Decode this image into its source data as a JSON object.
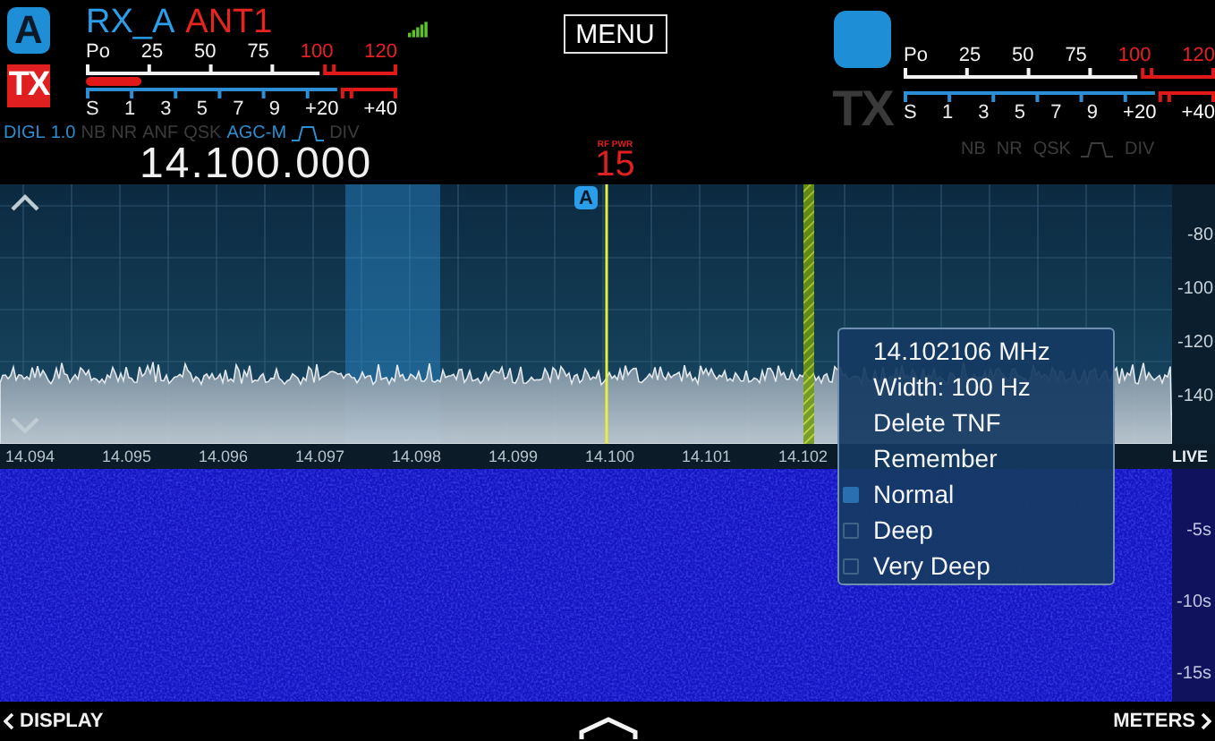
{
  "header": {
    "menu_button": "MENU",
    "rf_power": {
      "label": "RF PWR",
      "value": "15"
    }
  },
  "receivers": [
    {
      "badge": "A",
      "name": "RX_A",
      "antenna": "ANT1",
      "tx": {
        "label": "TX",
        "active": true
      },
      "power_scale": [
        {
          "text": "Po",
          "kind": "normal"
        },
        {
          "text": "25",
          "kind": "normal"
        },
        {
          "text": "50",
          "kind": "normal"
        },
        {
          "text": "75",
          "kind": "normal"
        },
        {
          "text": "100",
          "kind": "over"
        },
        {
          "text": "120",
          "kind": "over"
        }
      ],
      "power_meter": {
        "level": 0.18
      },
      "s_scale": [
        {
          "text": "S",
          "kind": "normal"
        },
        {
          "text": "1",
          "kind": "normal"
        },
        {
          "text": "3",
          "kind": "normal"
        },
        {
          "text": "5",
          "kind": "normal"
        },
        {
          "text": "7",
          "kind": "normal"
        },
        {
          "text": "9",
          "kind": "normal"
        },
        {
          "text": "+20",
          "kind": "over"
        },
        {
          "text": "+40",
          "kind": "over"
        }
      ],
      "modes": [
        {
          "kind": "text",
          "label": "DIGL",
          "on": true
        },
        {
          "kind": "text",
          "label": "1.0",
          "on": true
        },
        {
          "kind": "text",
          "label": "NB",
          "on": false
        },
        {
          "kind": "text",
          "label": "NR",
          "on": false
        },
        {
          "kind": "text",
          "label": "ANF",
          "on": false
        },
        {
          "kind": "text",
          "label": "QSK",
          "on": false
        },
        {
          "kind": "text",
          "label": "AGC-M",
          "on": true
        },
        {
          "kind": "filter",
          "on": true
        },
        {
          "kind": "text",
          "label": "DIV",
          "on": false
        }
      ],
      "frequency": "14.100.000"
    },
    {
      "tx": {
        "label": "TX",
        "active": false
      },
      "power_scale": [
        {
          "text": "Po",
          "kind": "normal"
        },
        {
          "text": "25",
          "kind": "normal"
        },
        {
          "text": "50",
          "kind": "normal"
        },
        {
          "text": "75",
          "kind": "normal"
        },
        {
          "text": "100",
          "kind": "over"
        },
        {
          "text": "120",
          "kind": "over"
        }
      ],
      "s_scale": [
        {
          "text": "S",
          "kind": "normal"
        },
        {
          "text": "1",
          "kind": "normal"
        },
        {
          "text": "3",
          "kind": "normal"
        },
        {
          "text": "5",
          "kind": "normal"
        },
        {
          "text": "7",
          "kind": "normal"
        },
        {
          "text": "9",
          "kind": "normal"
        },
        {
          "text": "+20",
          "kind": "over"
        },
        {
          "text": "+40",
          "kind": "over"
        }
      ],
      "modes": [
        {
          "kind": "text",
          "label": "NB",
          "on": false
        },
        {
          "kind": "text",
          "label": "NR",
          "on": false
        },
        {
          "kind": "text",
          "label": "QSK",
          "on": false
        },
        {
          "kind": "filter",
          "on": false
        },
        {
          "kind": "text",
          "label": "DIV",
          "on": false
        }
      ]
    }
  ],
  "spectrum": {
    "vfo_marker": "A",
    "db_labels": [
      "-80",
      "-100",
      "-120",
      "-140"
    ],
    "freq_labels": [
      "14.094",
      "14.095",
      "14.096",
      "14.097",
      "14.098",
      "14.099",
      "14.100",
      "14.101",
      "14.102"
    ],
    "live": "LIVE"
  },
  "waterfall": {
    "time_labels": [
      "-5s",
      "-10s",
      "-15s"
    ]
  },
  "tnf_menu": {
    "items": [
      {
        "kind": "info",
        "label": "14.102106 MHz"
      },
      {
        "kind": "info",
        "label": "Width: 100 Hz"
      },
      {
        "kind": "action",
        "label": "Delete TNF"
      },
      {
        "kind": "action",
        "label": "Remember"
      },
      {
        "kind": "option",
        "label": "Normal",
        "selected": true
      },
      {
        "kind": "option",
        "label": "Deep",
        "selected": false
      },
      {
        "kind": "option",
        "label": "Very Deep",
        "selected": false
      }
    ]
  },
  "footer": {
    "left": "DISPLAY",
    "right": "METERS"
  }
}
